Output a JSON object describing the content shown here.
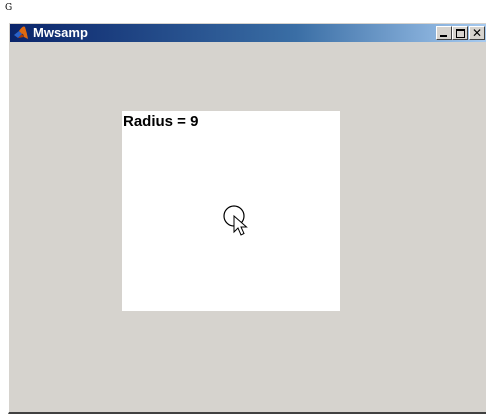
{
  "page": {
    "corner_label": "G"
  },
  "window": {
    "title": "Mwsamp",
    "icon": "matlab-icon",
    "controls": {
      "minimize": "minimize-icon",
      "maximize": "maximize-icon",
      "close": "close-icon"
    }
  },
  "canvas": {
    "radius_label": "Radius = 9",
    "radius_value": 9,
    "pointer_icon": "arrow-cursor-icon"
  },
  "colors": {
    "window_face": "#d6d3ce",
    "titlebar_start": "#0a246a",
    "titlebar_end": "#a6caf0",
    "canvas_bg": "#ffffff"
  }
}
